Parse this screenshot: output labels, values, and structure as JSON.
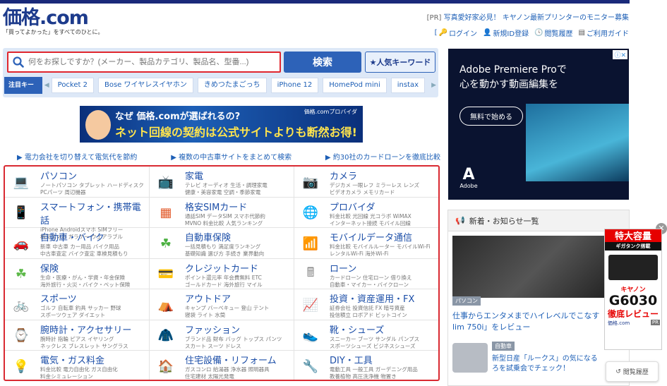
{
  "header": {
    "logo_main": "価格",
    "logo_dot": ".com",
    "tagline": "「買ってよかった」をすべてのひとに。",
    "pr_label": "[PR]",
    "pr_text": "写真愛好家必見！ キヤノン最新プリンターのモニター募集",
    "links": [
      "ログイン",
      "新規ID登録",
      "閲覧履歴",
      "ご利用ガイド"
    ]
  },
  "search": {
    "placeholder": "何をお探しですか？(メーカー、製品カテゴリ、製品名、型番...)",
    "button": "検索",
    "keyword_button": "★人気キーワード",
    "keyword_label": "注目キーワード",
    "keywords": [
      "Pocket 2",
      "Bose ワイヤレスイヤホン",
      "きめつたまごっち",
      "iPhone 12",
      "HomePod mini",
      "instax"
    ]
  },
  "banner": {
    "line1": "なぜ 価格.comが選ばれるの?",
    "line2": "ネット回線の契約は公式サイトよりも断然お得!",
    "provider": "価格.comプロバイダ"
  },
  "promos": [
    "▶ 電力会社を切り替えて電気代を節約",
    "▶ 複数の中古車サイトをまとめて検索",
    "▶ 約30社のカードローンを徹底比較"
  ],
  "categories": [
    {
      "title": "パソコン",
      "sub1": "ノートパソコン タブレット ハードディスク",
      "sub2": "PCパーツ 周辺機器",
      "icon": "laptop-icon",
      "color": "#5a6a80"
    },
    {
      "title": "家電",
      "sub1": "テレビ オーディオ 生活・調理家電",
      "sub2": "健康・美容家電 空調・季節家電",
      "icon": "tv-icon",
      "color": "#5a7a9a"
    },
    {
      "title": "カメラ",
      "sub1": "デジカメ 一眼レフ ミラーレス レンズ",
      "sub2": "ビデオカメラ メモリカード",
      "icon": "camera-icon",
      "color": "#444"
    },
    {
      "title": "スマートフォン・携帯電話",
      "sub1": "iPhone Androidスマホ SIMフリー",
      "sub2": "格安スマホ ガラケー ウェアラブル",
      "icon": "smartphone-icon",
      "color": "#4a78b8"
    },
    {
      "title": "格安SIMカード",
      "sub1": "通話SIM データSIM スマホ代節約",
      "sub2": "MVNO 料金比較 人気ランキング",
      "icon": "sim-card-icon",
      "color": "#e25a2a"
    },
    {
      "title": "プロバイダ",
      "sub1": "料金比較 光回線 光コラボ WiMAX",
      "sub2": "インターネット接続 モバイル回線",
      "icon": "globe-icon",
      "color": "#3a88d8"
    },
    {
      "title": "自動車・バイク",
      "sub1": "新車 中古車 カー用品 バイク用品",
      "sub2": "中古車査定 バイク査定 車検見積もり",
      "icon": "car-icon",
      "color": "#f0a800"
    },
    {
      "title": "自動車保険",
      "sub1": "一括見積もり 満足度ランキング",
      "sub2": "基礎知識 選び方 手続き 業界動向",
      "icon": "clover-car-icon",
      "color": "#4ab040"
    },
    {
      "title": "モバイルデータ通信",
      "sub1": "料金比較 モバイルルーター モバイルWi-Fi",
      "sub2": "レンタルWi-Fi 海外Wi-Fi",
      "icon": "wifi-icon",
      "color": "#20a878"
    },
    {
      "title": "保険",
      "sub1": "生命・医療・がん・学資・年金保険",
      "sub2": "海外旅行・火災・バイク・ペット保険",
      "icon": "clover-icon",
      "color": "#5cb848"
    },
    {
      "title": "クレジットカード",
      "sub1": "ポイント還元率 年会費無料 ETC",
      "sub2": "ゴールドカード 海外旅行 マイル",
      "icon": "credit-card-icon",
      "color": "#e878a8"
    },
    {
      "title": "ローン",
      "sub1": "カードローン 住宅ローン 借り換え",
      "sub2": "自動車・マイカー・バイクローン",
      "icon": "calculator-icon",
      "color": "#8a8a8a"
    },
    {
      "title": "スポーツ",
      "sub1": "ゴルフ 自転車 釣具 サッカー 野球",
      "sub2": "スポーツウェア ダイエット",
      "icon": "bicycle-icon",
      "color": "#e2442a"
    },
    {
      "title": "アウトドア",
      "sub1": "キャンプ バーベキュー 登山 テント",
      "sub2": "寝袋 ライト 水筒",
      "icon": "tent-icon",
      "color": "#4a9a40"
    },
    {
      "title": "投資・資産運用・FX",
      "sub1": "証券会社 投資信託 FX 暗号資産",
      "sub2": "投信積立 ロボアド ビットコイン",
      "icon": "chart-icon",
      "color": "#e8a020"
    },
    {
      "title": "腕時計・アクセサリー",
      "sub1": "腕時計 指輪 ピアス イヤリング",
      "sub2": "ネックレス ブレスレット サングラス",
      "icon": "watch-icon",
      "color": "#3a6ab8"
    },
    {
      "title": "ファッション",
      "sub1": "ブランド品 財布 バッグ トップス パンツ",
      "sub2": "スカート スーツ ドレス",
      "icon": "jacket-icon",
      "color": "#c82a3a"
    },
    {
      "title": "靴・シューズ",
      "sub1": "スニーカー ブーツ サンダル パンプス",
      "sub2": "スポーツシューズ ビジネスシューズ",
      "icon": "shoe-icon",
      "color": "#d82a4a"
    },
    {
      "title": "電気・ガス料金",
      "sub1": "料金比較 電力自由化 ガス自由化",
      "sub2": "料金シミュレーション",
      "icon": "bulb-flame-icon",
      "color": "#f0b020"
    },
    {
      "title": "住宅設備・リフォーム",
      "sub1": "ガスコンロ 給湯器 浄水器 照明器具",
      "sub2": "住宅建材 太陽光発電",
      "icon": "house-icon",
      "color": "#c8702a"
    },
    {
      "title": "DIY・工具",
      "sub1": "電動工具 一般工具 ガーデニング用品",
      "sub2": "教養植物 高圧洗浄機 物置き",
      "icon": "drill-icon",
      "color": "#e07020"
    }
  ],
  "ad": {
    "headline1": "Adobe Premiere Proで",
    "headline2": "心を動かす動画編集を",
    "button": "無料で始める",
    "brand": "Adobe"
  },
  "news": {
    "header": "新着・お知らせ一覧",
    "item1_category": "パソコン",
    "item1_title": "仕事からエンタメまでハイレベルでこなす「Y",
    "item1_title2": "lim 750i」をレビュー",
    "item2_category": "自動車",
    "item2_title": "新型日産「ルークス」の気になる",
    "item2_title2": "ろを試乗会でチェック！"
  },
  "printer_ad": {
    "top": "特大容量",
    "sub": "ギガタンク搭載",
    "brand": "キヤノン",
    "model": "G6030",
    "review": "徹底レビュー",
    "logo": "価格.com",
    "pr": "PR"
  },
  "history_button": "閲覧履歴"
}
